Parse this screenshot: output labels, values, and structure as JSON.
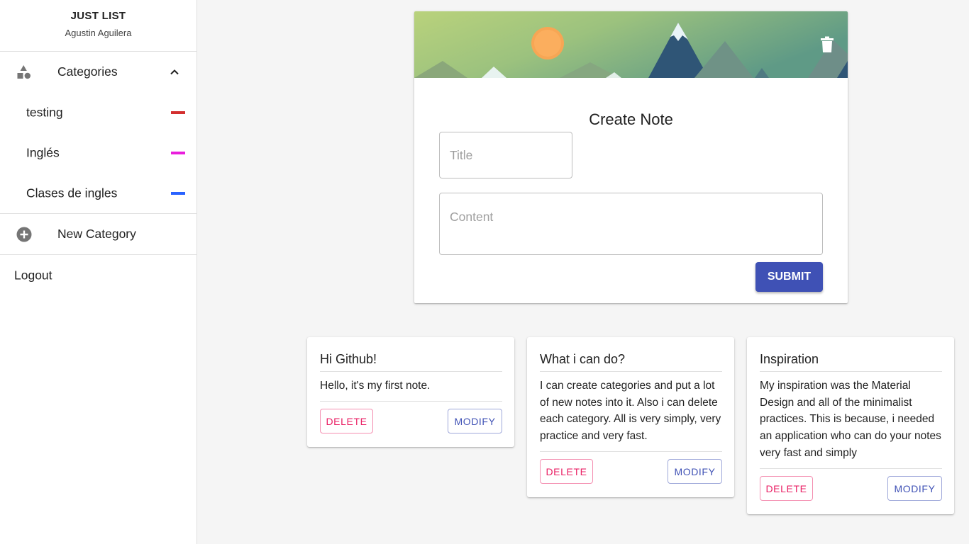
{
  "app": {
    "title": "JUST LIST",
    "user": "Agustin Aguilera"
  },
  "sidebar": {
    "categories_label": "Categories",
    "categories": [
      {
        "label": "testing",
        "color": "#d32f2f"
      },
      {
        "label": "Inglés",
        "color": "#e91edc"
      },
      {
        "label": "Clases de ingles",
        "color": "#2962ff"
      }
    ],
    "new_category_label": "New Category",
    "logout_label": "Logout"
  },
  "create_note": {
    "heading": "Create Note",
    "title_placeholder": "Title",
    "content_placeholder": "Content",
    "submit_label": "SUBMIT"
  },
  "notes": [
    {
      "title": "Hi Github!",
      "body": "Hello, it's my first note.",
      "delete_label": "DELETE",
      "modify_label": "MODIFY"
    },
    {
      "title": "What i can do?",
      "body": "I can create categories and put a lot of new notes into it. Also i can delete each category. All is very simply, very practice and very fast.",
      "delete_label": "DELETE",
      "modify_label": "MODIFY"
    },
    {
      "title": "Inspiration",
      "body": "My inspiration was the Material Design and all of the minimalist practices. This is because, i needed an application who can do your notes very fast and simply",
      "delete_label": "DELETE",
      "modify_label": "MODIFY"
    }
  ],
  "colors": {
    "primary": "#3f51b5",
    "danger": "#e91e63"
  }
}
